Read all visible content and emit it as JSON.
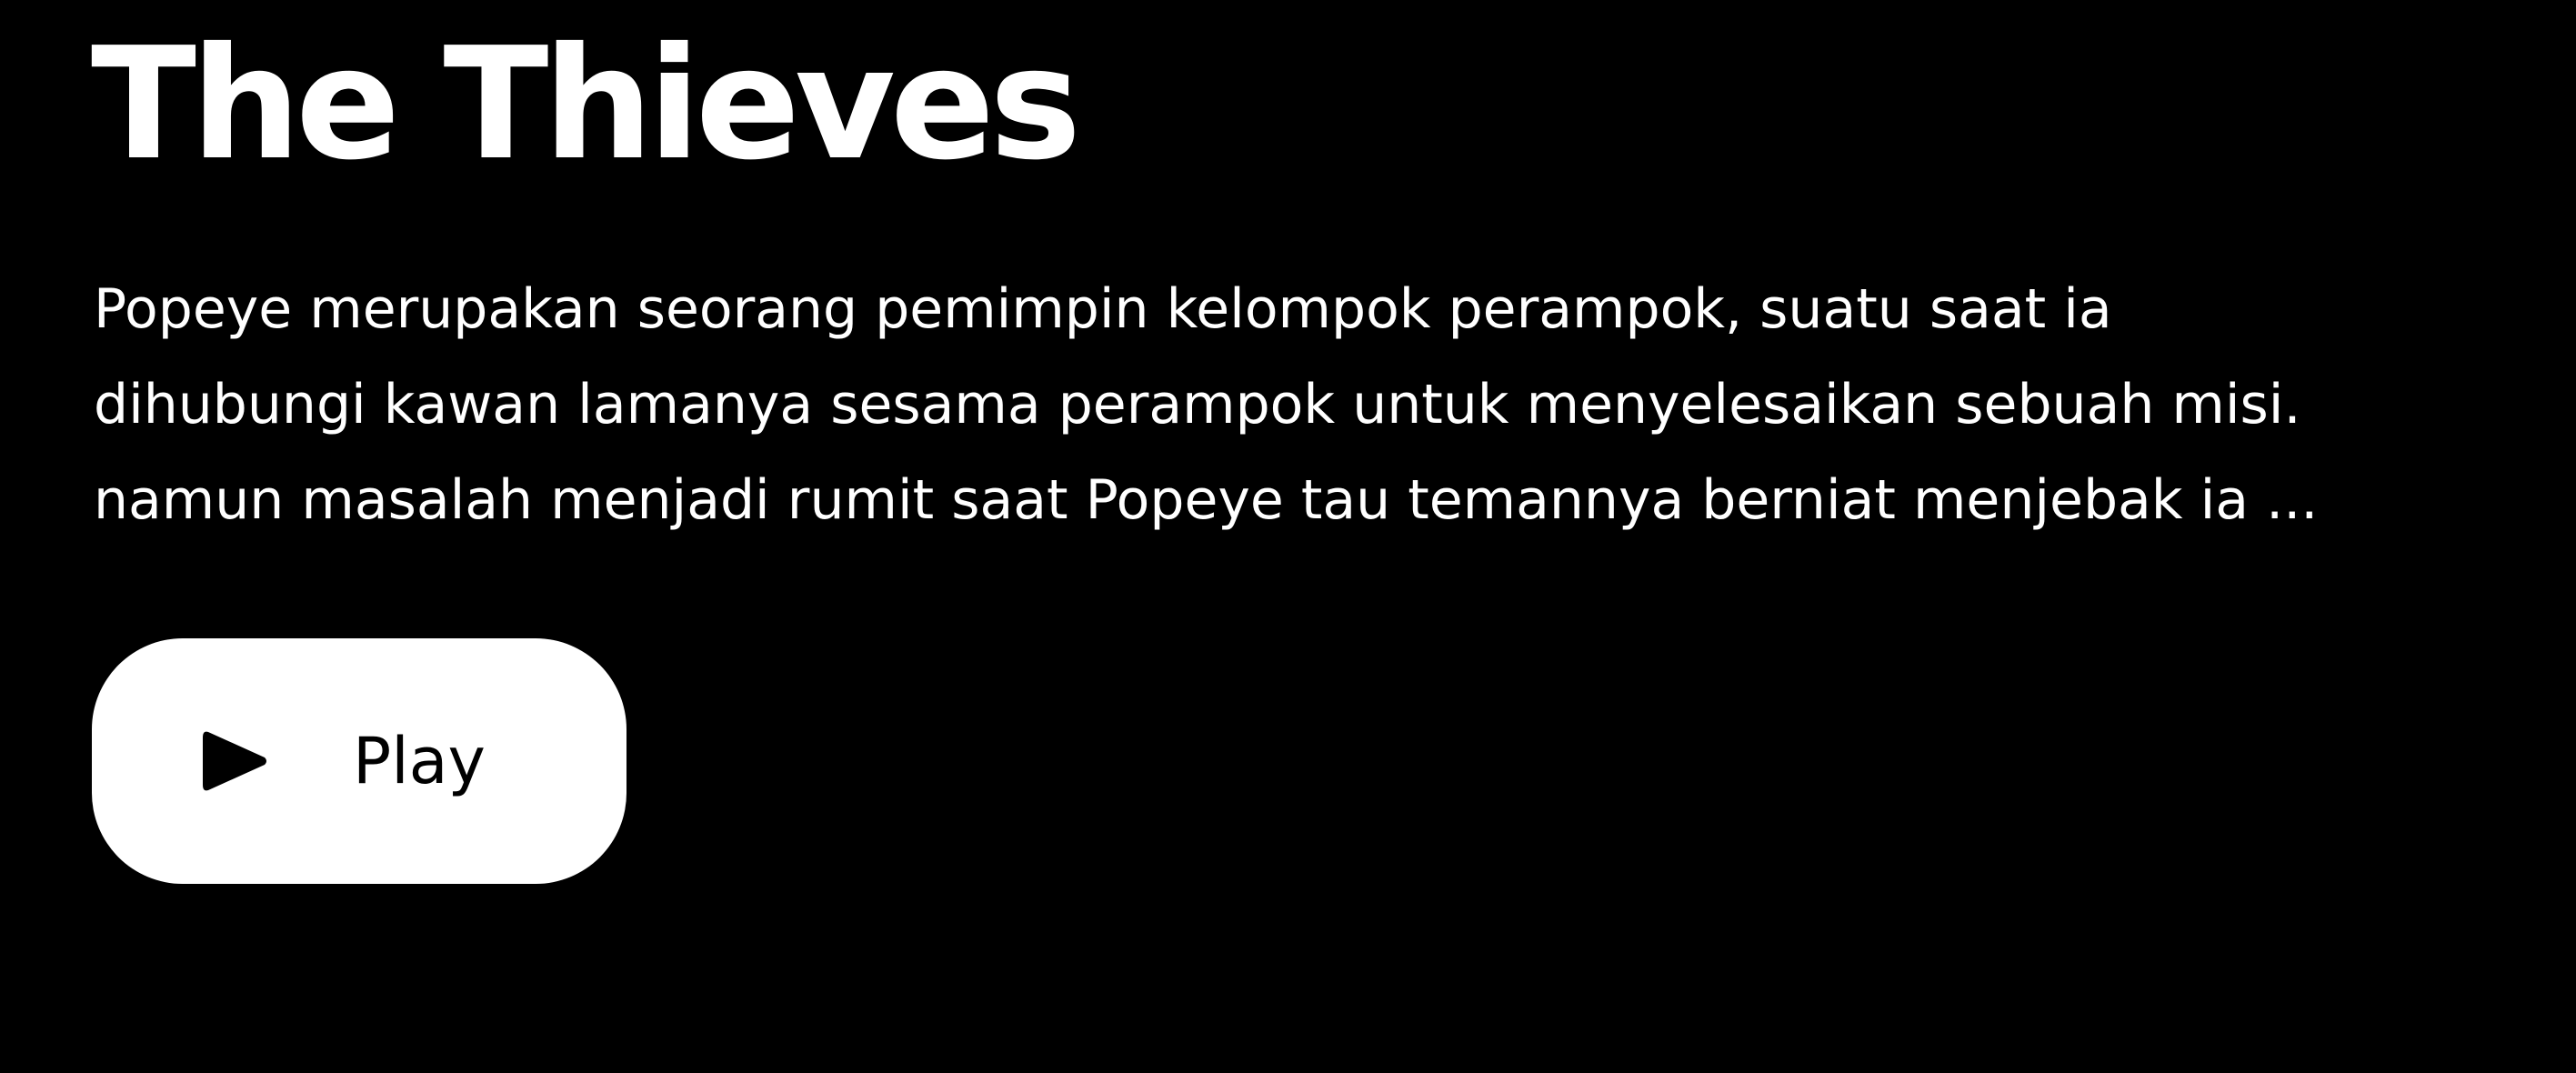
{
  "title": "The Thieves",
  "synopsis": {
    "lines": [
      "Popeye merupakan seorang pemimpin kelompok perampok, suatu saat ia",
      "dihubungi kawan lamanya sesama perampok untuk menyelesaikan sebuah misi.",
      "namun masalah menjadi rumit saat Popeye tau temannya berniat menjebak ia ..."
    ]
  },
  "play_button": {
    "label": "Play",
    "icon": "play-icon"
  },
  "colors": {
    "background": "#000000",
    "text": "#ffffff",
    "button_background": "#ffffff",
    "button_text": "#000000"
  }
}
